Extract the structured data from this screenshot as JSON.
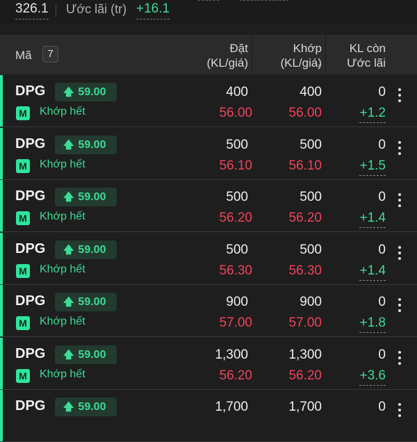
{
  "summary": {
    "value_1": "326.1",
    "estimated_profit_label": "Ước lãi (tr)",
    "estimated_profit_value": "+16.1"
  },
  "header": {
    "ma_label": "Mã",
    "count": "7",
    "dat_line1": "Đặt",
    "dat_line2": "(KL/giá)",
    "khop_line1": "Khớp",
    "khop_line2": "(KL/giá)",
    "kl_line1": "KL còn",
    "kl_line2": "Ước lãi"
  },
  "colors": {
    "accent_green": "#2ee59d",
    "price_red": "#f0435a",
    "text_green": "#3ddc97",
    "background": "#1e1e1e"
  },
  "rows": [
    {
      "symbol": "DPG",
      "price": "59.00",
      "m": "M",
      "status": "Khớp hết",
      "dat_kl": "400",
      "dat_gia": "56.00",
      "khop_kl": "400",
      "khop_gia": "56.00",
      "con": "0",
      "lai": "+1.2"
    },
    {
      "symbol": "DPG",
      "price": "59.00",
      "m": "M",
      "status": "Khớp hết",
      "dat_kl": "500",
      "dat_gia": "56.10",
      "khop_kl": "500",
      "khop_gia": "56.10",
      "con": "0",
      "lai": "+1.5"
    },
    {
      "symbol": "DPG",
      "price": "59.00",
      "m": "M",
      "status": "Khớp hết",
      "dat_kl": "500",
      "dat_gia": "56.20",
      "khop_kl": "500",
      "khop_gia": "56.20",
      "con": "0",
      "lai": "+1.4"
    },
    {
      "symbol": "DPG",
      "price": "59.00",
      "m": "M",
      "status": "Khớp hết",
      "dat_kl": "500",
      "dat_gia": "56.30",
      "khop_kl": "500",
      "khop_gia": "56.30",
      "con": "0",
      "lai": "+1.4"
    },
    {
      "symbol": "DPG",
      "price": "59.00",
      "m": "M",
      "status": "Khớp hết",
      "dat_kl": "900",
      "dat_gia": "57.00",
      "khop_kl": "900",
      "khop_gia": "57.00",
      "con": "0",
      "lai": "+1.8"
    },
    {
      "symbol": "DPG",
      "price": "59.00",
      "m": "M",
      "status": "Khớp hết",
      "dat_kl": "1,300",
      "dat_gia": "56.20",
      "khop_kl": "1,300",
      "khop_gia": "56.20",
      "con": "0",
      "lai": "+3.6"
    },
    {
      "symbol": "DPG",
      "price": "59.00",
      "m": "",
      "status": "",
      "dat_kl": "1,700",
      "dat_gia": "",
      "khop_kl": "1,700",
      "khop_gia": "",
      "con": "0",
      "lai": ""
    }
  ]
}
